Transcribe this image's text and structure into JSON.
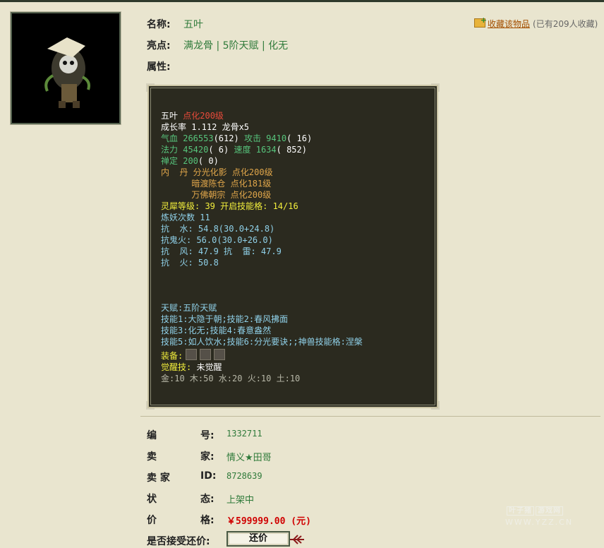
{
  "item": {
    "name_label": "名称:",
    "name": "五叶",
    "highlights_label": "亮点:",
    "highlights": "满龙骨 | 5阶天赋 | 化无",
    "attributes_label": "属性:"
  },
  "favorite": {
    "icon": "folder-plus-icon",
    "link_text": "收藏该物品",
    "count_text": "(已有209人收藏)"
  },
  "panel": {
    "line1": {
      "name": "五叶",
      "level": "点化200级"
    },
    "line2": {
      "a": "成长率 1.112 龙骨x5"
    },
    "line3": {
      "a": "气血 266553",
      "b": "(612)",
      "c": "攻击 9410",
      "d": "( 16)"
    },
    "line4": {
      "a": "法力 45420",
      "b": "( 6)",
      "c": "速度 1634",
      "d": "( 852)"
    },
    "line5": {
      "a": "禅定 200",
      "b": "( 0)"
    },
    "line6": {
      "a": "内  丹 分光化影 点化200级"
    },
    "line7": {
      "a": "      暗渡陈仓 点化181级"
    },
    "line8": {
      "a": "      万佛朝宗 点化200级"
    },
    "line9": {
      "a": "灵犀等级: 39 开启技能格: 14/16"
    },
    "line10": {
      "a": "炼妖次数 11"
    },
    "line11": {
      "a": "抗  水: 54.8(30.0+24.8)"
    },
    "line12": {
      "a": "抗鬼火: 56.0(30.0+26.0)"
    },
    "line13": {
      "a": "抗  风: 47.9 抗  雷: 47.9"
    },
    "line14": {
      "a": "抗  火: 50.8"
    },
    "line15": {
      "a": "天赋:五阶天赋"
    },
    "line16": {
      "a": "技能1:大隐于朝;技能2:春风拂面"
    },
    "line17": {
      "a": "技能3:化无;技能4:春意盎然"
    },
    "line18": {
      "a": "技能5:如人饮水;技能6:分光要诀;;神兽技能格:涅槃"
    },
    "line19": {
      "a": "装备:"
    },
    "line20": {
      "a": "觉醒技:",
      "b": "未觉醒"
    },
    "line21": {
      "a": "金:10 木:50 水:20 火:10 土:10"
    }
  },
  "details": {
    "id_label_1": "编",
    "id_label_2": "号:",
    "id_value": "1332711",
    "seller_label_1": "卖",
    "seller_label_2": "家:",
    "seller_value": "情义★田哥",
    "seller_id_label_1": "卖 家",
    "seller_id_label_2": "ID:",
    "seller_id_value": "8728639",
    "status_label_1": "状",
    "status_label_2": "态:",
    "status_value": "上架中",
    "price_label_1": "价",
    "price_label_2": "格:",
    "price_value": "￥599999.00 (元)",
    "bargain_label": "是否接受还价:",
    "bargain_button": "还价"
  },
  "watermark": {
    "line1": "叶子猪",
    "badge": "游戏网",
    "line2": "WWW.YZZ.CN"
  },
  "colors": {
    "accent_green": "#2f7a3a",
    "price_red": "#d00000",
    "panel_bg": "#2b2a1f",
    "page_bg": "#e9e5cf"
  }
}
